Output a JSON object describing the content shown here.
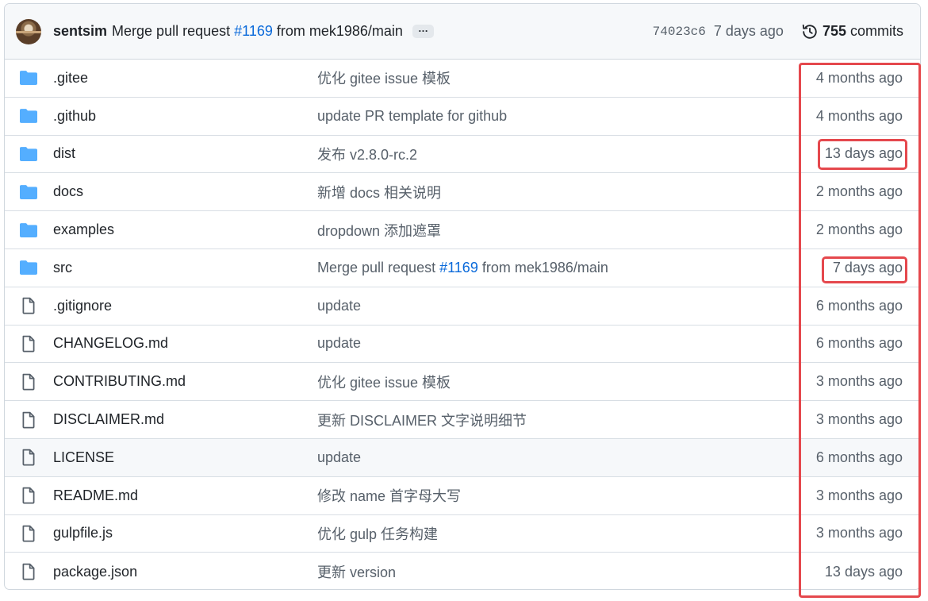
{
  "commit": {
    "author": "sentsim",
    "message_prefix": "Merge pull request",
    "pr_link": "#1169",
    "message_suffix": "from mek1986/main",
    "ellipsis": "…",
    "sha": "74023c6",
    "time": "7 days ago",
    "commit_count": "755",
    "commit_label": "commits"
  },
  "files": [
    {
      "type": "folder",
      "name": ".gitee",
      "message": "优化 gitee issue 模板",
      "time": "4 months ago"
    },
    {
      "type": "folder",
      "name": ".github",
      "message": "update PR template for github",
      "time": "4 months ago"
    },
    {
      "type": "folder",
      "name": "dist",
      "message": "发布 v2.8.0-rc.2",
      "time": "13 days ago"
    },
    {
      "type": "folder",
      "name": "docs",
      "message": "新增 docs 相关说明",
      "time": "2 months ago"
    },
    {
      "type": "folder",
      "name": "examples",
      "message": "dropdown 添加遮罩",
      "time": "2 months ago"
    },
    {
      "type": "folder",
      "name": "src",
      "message_prefix": "Merge pull request",
      "message_link": "#1169",
      "message_suffix": "from mek1986/main",
      "time": "7 days ago"
    },
    {
      "type": "file",
      "name": ".gitignore",
      "message": "update",
      "time": "6 months ago"
    },
    {
      "type": "file",
      "name": "CHANGELOG.md",
      "message": "update",
      "time": "6 months ago"
    },
    {
      "type": "file",
      "name": "CONTRIBUTING.md",
      "message": "优化 gitee issue 模板",
      "time": "3 months ago"
    },
    {
      "type": "file",
      "name": "DISCLAIMER.md",
      "message": "更新 DISCLAIMER 文字说明细节",
      "time": "3 months ago"
    },
    {
      "type": "file",
      "name": "LICENSE",
      "message": "update",
      "time": "6 months ago"
    },
    {
      "type": "file",
      "name": "README.md",
      "message": "修改 name 首字母大写",
      "time": "3 months ago"
    },
    {
      "type": "file",
      "name": "gulpfile.js",
      "message": "优化 gulp 任务构建",
      "time": "3 months ago"
    },
    {
      "type": "file",
      "name": "package.json",
      "message": "更新 version",
      "time": "13 days ago"
    }
  ],
  "colors": {
    "folder_icon": "#54aeff",
    "file_icon": "#57606a",
    "link": "#0969da",
    "annotation": "#e5484d"
  }
}
